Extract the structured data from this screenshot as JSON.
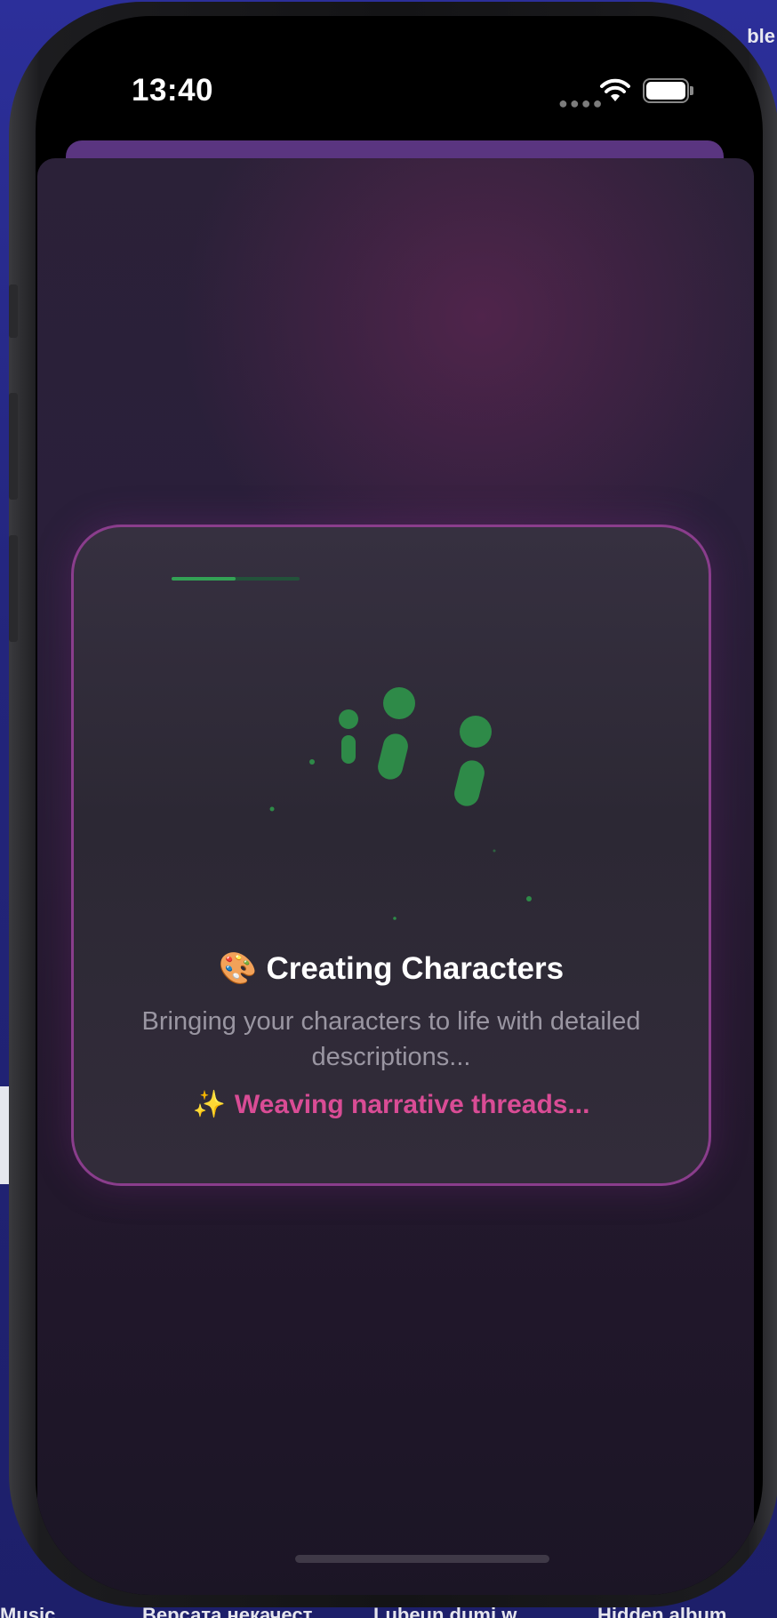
{
  "desktop": {
    "corner_text": "ble",
    "bottom_labels": [
      "Music",
      "Версата некачест",
      "Lubeun dumi w",
      "Hidden album"
    ]
  },
  "status_bar": {
    "time": "13:40",
    "signal_icon": "cellular-dots-icon",
    "wifi_icon": "wifi-icon",
    "battery_icon": "battery-icon",
    "battery_level": 1.0
  },
  "loading_card": {
    "progress": 0.5,
    "animation_icon": "bouncing-info-figures-icon",
    "title_emoji": "🎨",
    "title": "Creating Characters",
    "subtitle": "Bringing your characters to life with detailed descriptions...",
    "status_emoji": "✨",
    "status": "Weaving narrative threads..."
  },
  "colors": {
    "accent_pink": "#d94c95",
    "accent_green": "#33a255",
    "card_border": "#8a3d8c",
    "sheet_top": "#5a3580"
  }
}
